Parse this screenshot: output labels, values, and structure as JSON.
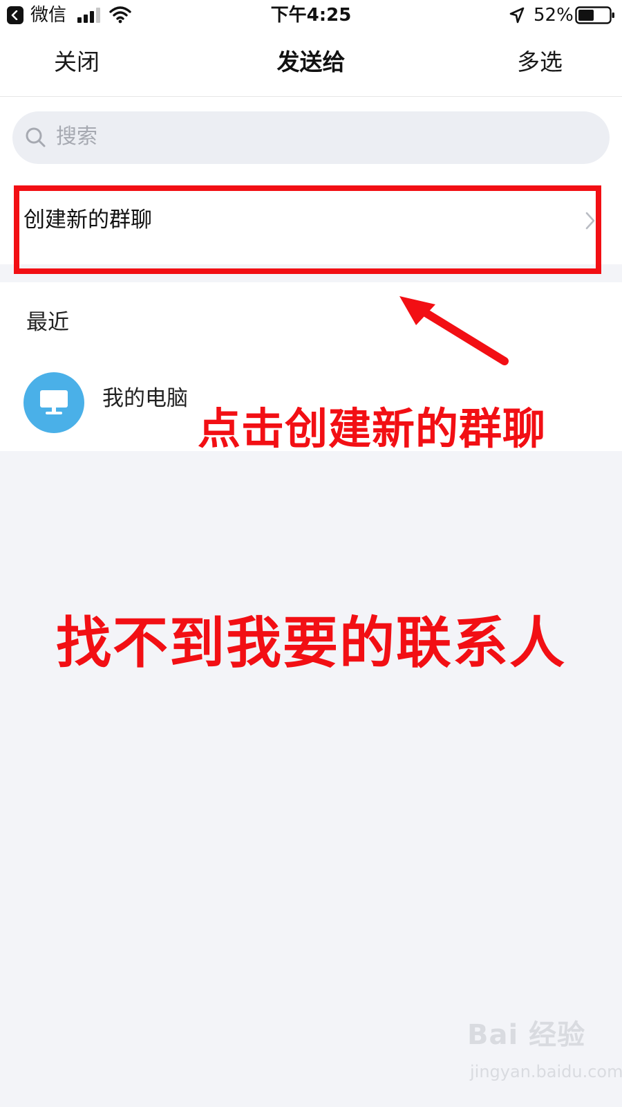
{
  "status_bar": {
    "back_app": "微信",
    "time": "下午4:25",
    "battery_percent": "52%",
    "battery_level": 0.52
  },
  "nav": {
    "close_label": "关闭",
    "title": "发送给",
    "multi_select_label": "多选"
  },
  "search": {
    "placeholder": "搜索"
  },
  "create_group": {
    "label": "创建新的群聊"
  },
  "recent": {
    "heading": "最近",
    "items": [
      {
        "name": "我的电脑",
        "icon": "monitor-icon"
      }
    ]
  },
  "annotations": {
    "click_hint": "点击创建新的群聊",
    "not_found": "找不到我要的联系人",
    "color": "#f20f14"
  },
  "watermark": {
    "brand": "Bai 经验",
    "url": "jingyan.baidu.com"
  },
  "colors": {
    "avatar_blue": "#4ab0e8",
    "background": "#f3f4f8"
  }
}
